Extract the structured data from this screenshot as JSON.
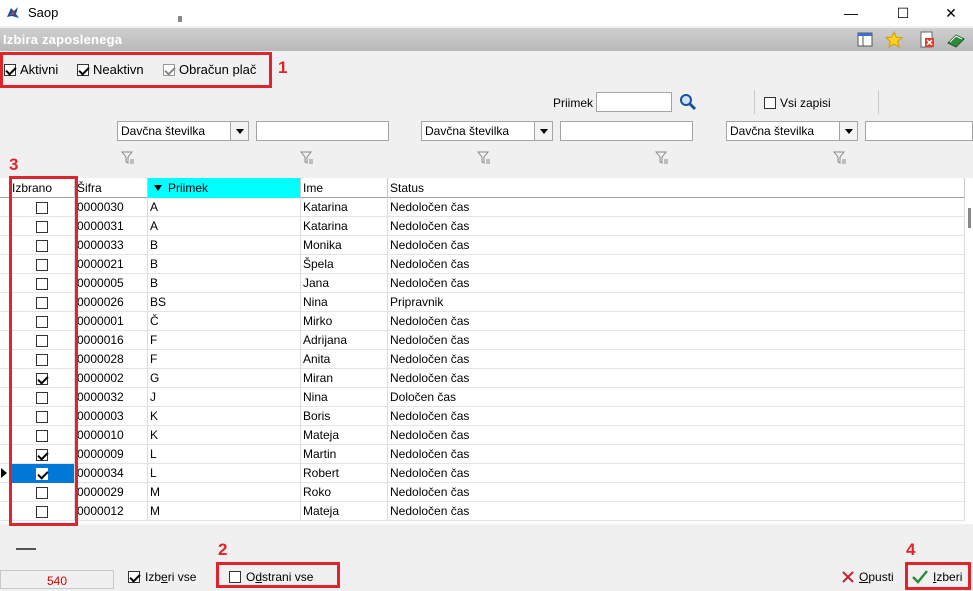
{
  "window": {
    "title": "Saop",
    "minimize": "—",
    "maximize": "☐",
    "close": "✕"
  },
  "header": {
    "title": "Izbira zaposlenega"
  },
  "filters": {
    "aktivni": {
      "label": "Aktivni",
      "checked": true
    },
    "neaktivni": {
      "label": "Neaktivn",
      "checked": true
    },
    "obracun": {
      "label": "Obračun plač",
      "checked": true,
      "disabled": true
    },
    "priimek_label": "Priimek",
    "vsi_zapisi_label": "Vsi zapisi",
    "combo1": "Davčna številka",
    "combo2": "Davčna številka",
    "combo3": "Davčna številka"
  },
  "callouts": {
    "n1": "1",
    "n2": "2",
    "n3": "3",
    "n4": "4"
  },
  "grid": {
    "columns": [
      "Izbrano",
      "Šifra",
      "Priimek",
      "Ime",
      "Status"
    ],
    "rows": [
      {
        "izbrano": false,
        "sifra": "0000030",
        "priimek": "A",
        "ime": "Katarina",
        "status": "Nedoločen čas"
      },
      {
        "izbrano": false,
        "sifra": "0000031",
        "priimek": "A",
        "ime": "Katarina",
        "status": "Nedoločen čas"
      },
      {
        "izbrano": false,
        "sifra": "0000033",
        "priimek": "B",
        "ime": "Monika",
        "status": "Nedoločen čas"
      },
      {
        "izbrano": false,
        "sifra": "0000021",
        "priimek": "B",
        "ime": "Špela",
        "status": "Nedoločen čas"
      },
      {
        "izbrano": false,
        "sifra": "0000005",
        "priimek": "B",
        "ime": "Jana",
        "status": "Nedoločen čas"
      },
      {
        "izbrano": false,
        "sifra": "0000026",
        "priimek": "BS",
        "ime": "Nina",
        "status": "Pripravnik"
      },
      {
        "izbrano": false,
        "sifra": "0000001",
        "priimek": "Č",
        "ime": "Mirko",
        "status": "Nedoločen čas"
      },
      {
        "izbrano": false,
        "sifra": "0000016",
        "priimek": "F",
        "ime": "Adrijana",
        "status": "Nedoločen čas"
      },
      {
        "izbrano": false,
        "sifra": "0000028",
        "priimek": "F",
        "ime": "Anita",
        "status": "Nedoločen čas"
      },
      {
        "izbrano": true,
        "sifra": "0000002",
        "priimek": "G",
        "ime": "Miran",
        "status": "Nedoločen čas"
      },
      {
        "izbrano": false,
        "sifra": "0000032",
        "priimek": "J",
        "ime": "Nina",
        "status": "Določen čas"
      },
      {
        "izbrano": false,
        "sifra": "0000003",
        "priimek": "K",
        "ime": "Boris",
        "status": "Nedoločen čas"
      },
      {
        "izbrano": false,
        "sifra": "0000010",
        "priimek": "K",
        "ime": "Mateja",
        "status": "Nedoločen čas"
      },
      {
        "izbrano": true,
        "sifra": "0000009",
        "priimek": "L",
        "ime": "Martin",
        "status": "Nedoločen čas"
      },
      {
        "izbrano": true,
        "sifra": "0000034",
        "priimek": "L",
        "ime": "Robert",
        "status": "Nedoločen čas",
        "current": true
      },
      {
        "izbrano": false,
        "sifra": "0000029",
        "priimek": "M",
        "ime": "Roko",
        "status": "Nedoločen čas"
      },
      {
        "izbrano": false,
        "sifra": "0000012",
        "priimek": "M",
        "ime": "Mateja",
        "status": "Nedoločen čas"
      }
    ]
  },
  "footer": {
    "count": "540",
    "izberi_vse": "Izberi vse",
    "odstrani_vse": "Odstrani vse",
    "opusti": "Opusti",
    "izberi": "Izberi"
  },
  "colors": {
    "accent_red": "#e0242b",
    "sorted_header": "#00ffff",
    "selection": "#0078d7"
  }
}
